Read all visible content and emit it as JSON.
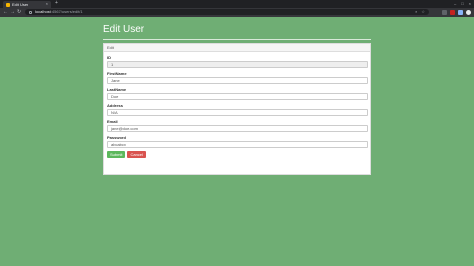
{
  "browser": {
    "tab_title": "Edit User",
    "tab_close": "×",
    "new_tab": "+",
    "url_host": "localhost",
    "url_path": ":4567/users/edit/1",
    "nav_back": "←",
    "nav_forward": "→",
    "nav_reload": "↻",
    "minimize": "–",
    "maximize": "□",
    "close": "×",
    "zoom_icon": "⌕",
    "star_icon": "☆",
    "extension_colors": [
      "#5f6368",
      "#c5221f",
      "#8ab4f8",
      "#e8eaed"
    ]
  },
  "page": {
    "title": "Edit User"
  },
  "form": {
    "header": "Edit",
    "fields": [
      {
        "label": "ID",
        "value": "1",
        "readonly": true
      },
      {
        "label": "FirstName",
        "value": "Jane",
        "readonly": false
      },
      {
        "label": "LastName",
        "value": "Doe",
        "readonly": false
      },
      {
        "label": "Address",
        "value": "N/A",
        "readonly": false
      },
      {
        "label": "Email",
        "value": "jane@doe.com",
        "readonly": false
      },
      {
        "label": "Password",
        "value": "abcabcx",
        "readonly": false
      }
    ],
    "submit_label": "Submit",
    "cancel_label": "Cancel"
  },
  "colors": {
    "background": "#6fae74",
    "submit": "#5cb85c",
    "cancel": "#d9534f"
  }
}
